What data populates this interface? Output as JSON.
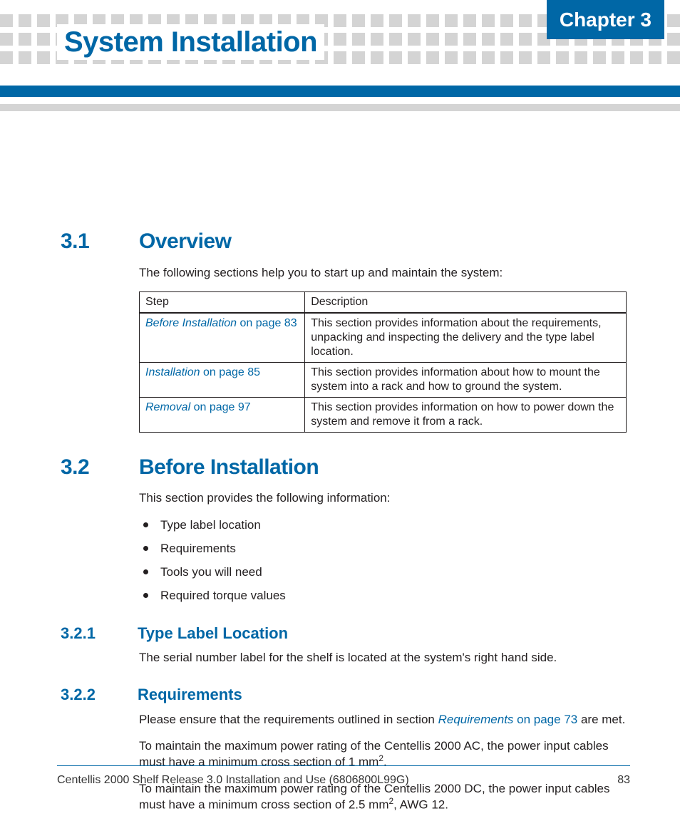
{
  "header": {
    "chapter_label": "Chapter 3",
    "page_title": "System Installation"
  },
  "sections": {
    "s31": {
      "num": "3.1",
      "title": "Overview",
      "intro": "The following sections help you to start up and maintain the system:"
    },
    "s32": {
      "num": "3.2",
      "title": "Before Installation",
      "intro": "This section provides the following information:"
    },
    "s321": {
      "num": "3.2.1",
      "title": "Type Label Location",
      "body": "The serial number label for the shelf is located at the system's right hand side."
    },
    "s322": {
      "num": "3.2.2",
      "title": "Requirements",
      "p1_pre": "Please ensure that the requirements outlined in section ",
      "p1_link_italic": "Requirements",
      "p1_link_rest": " on page 73",
      "p1_post": " are met.",
      "p2_pre": "To maintain the maximum power rating of the Centellis 2000 AC, the power input cables must have a minimum cross section of 1 mm",
      "p2_post": ".",
      "p3_pre": "To maintain the maximum power rating of the Centellis 2000 DC, the power input cables must have a minimum cross section of 2.5 mm",
      "p3_post": ", AWG 12."
    }
  },
  "table": {
    "head_step": "Step",
    "head_desc": "Description",
    "rows": [
      {
        "step_italic": "Before Installation",
        "step_rest": " on page 83",
        "desc": "This section provides information about the requirements, unpacking and inspecting the delivery and the type label location."
      },
      {
        "step_italic": "Installation",
        "step_rest": " on page 85",
        "desc": "This section provides information about how to mount the system into a rack and how to ground the system."
      },
      {
        "step_italic": "Removal",
        "step_rest": " on page 97",
        "desc": "This section provides information on how to power down the system and remove it from a rack."
      }
    ]
  },
  "bullets": {
    "b0": "Type label location",
    "b1": "Requirements",
    "b2": "Tools you will need",
    "b3": "Required torque values"
  },
  "footer": {
    "doc": "Centellis 2000 Shelf Release 3.0 Installation and Use (6806800L99G)",
    "page": "83"
  },
  "sup2": "2"
}
